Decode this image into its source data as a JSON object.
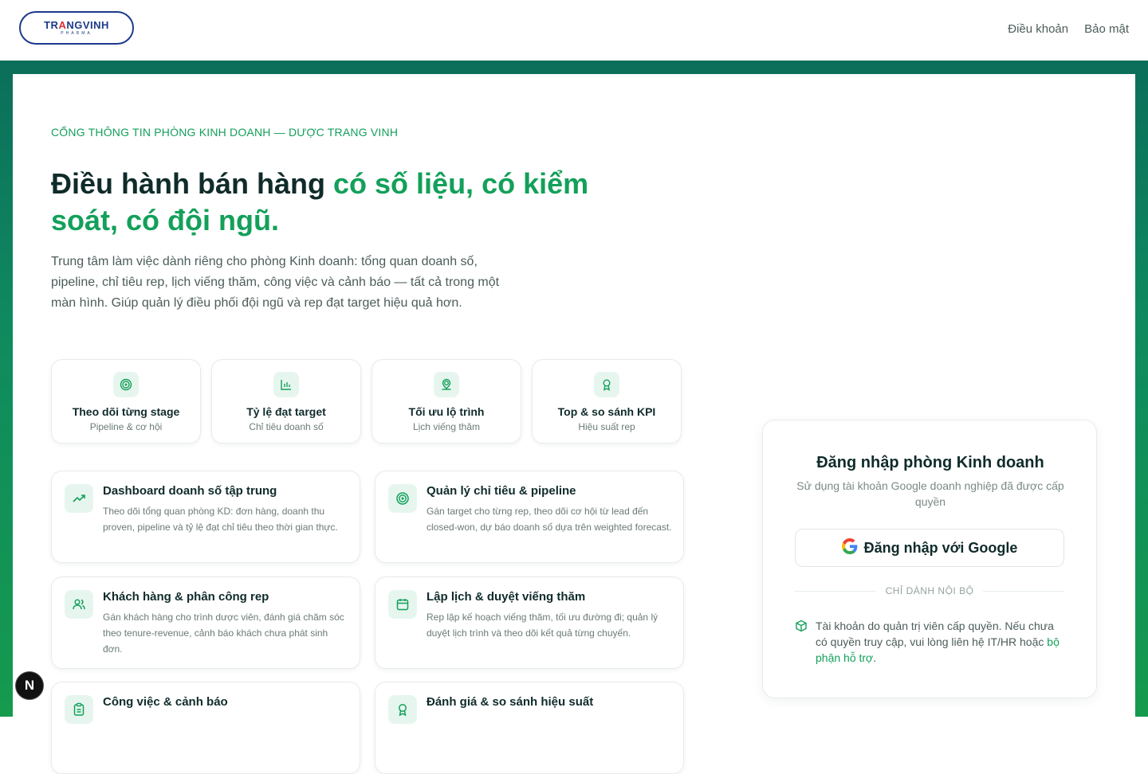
{
  "header": {
    "logo": {
      "brand_a": "TR",
      "brand_accent": "A",
      "brand_b": "NGVINH",
      "sub": "PHARMA"
    },
    "nav": [
      {
        "label": "Điều khoản"
      },
      {
        "label": "Bảo mật"
      }
    ]
  },
  "hero": {
    "eyebrow": "CỔNG THÔNG TIN PHÒNG KINH DOANH — DƯỢC TRANG VINH",
    "title_plain": "Điều hành bán hàng ",
    "title_highlight": "có số liệu, có kiểm soát, có đội ngũ.",
    "description": "Trung tâm làm việc dành riêng cho phòng Kinh doanh: tổng quan doanh số, pipeline, chỉ tiêu rep, lịch viếng thăm, công việc và cảnh báo — tất cả trong một màn hình. Giúp quản lý điều phối đội ngũ và rep đạt target hiệu quả hơn."
  },
  "stats": [
    {
      "title": "Theo dõi từng stage",
      "sub": "Pipeline & cơ hội",
      "icon": "target-icon"
    },
    {
      "title": "Tỷ lệ đạt target",
      "sub": "Chỉ tiêu doanh số",
      "icon": "bar-chart-icon"
    },
    {
      "title": "Tối ưu lộ trình",
      "sub": "Lịch viếng thăm",
      "icon": "map-pin-icon"
    },
    {
      "title": "Top & so sánh KPI",
      "sub": "Hiệu suất rep",
      "icon": "award-icon"
    }
  ],
  "features": [
    {
      "title": "Dashboard doanh số tập trung",
      "desc": "Theo dõi tổng quan phòng KD: đơn hàng, doanh thu proven, pipeline và tỷ lệ đạt chỉ tiêu theo thời gian thực.",
      "icon": "trending-up-icon"
    },
    {
      "title": "Quản lý chỉ tiêu & pipeline",
      "desc": "Gán target cho từng rep, theo dõi cơ hội từ lead đến closed-won, dự báo doanh số dựa trên weighted forecast.",
      "icon": "target-icon"
    },
    {
      "title": "Khách hàng & phân công rep",
      "desc": "Gán khách hàng cho trình dược viên, đánh giá chăm sóc theo tenure-revenue, cảnh báo khách chưa phát sinh đơn.",
      "icon": "users-icon"
    },
    {
      "title": "Lập lịch & duyệt viếng thăm",
      "desc": "Rep lập kế hoạch viếng thăm, tối ưu đường đi; quản lý duyệt lịch trình và theo dõi kết quả từng chuyến.",
      "icon": "calendar-icon"
    },
    {
      "title": "Công việc & cảnh báo",
      "desc": "",
      "icon": "clipboard-icon"
    },
    {
      "title": "Đánh giá & so sánh hiệu suất",
      "desc": "",
      "icon": "award-icon"
    }
  ],
  "login": {
    "title": "Đăng nhập phòng Kinh doanh",
    "subtitle": "Sử dụng tài khoản Google doanh nghiệp đã được cấp quyền",
    "google_button": "Đăng nhập với Google",
    "divider": "CHỈ DÀNH NỘI BỘ",
    "note_text": "Tài khoản do quản trị viên cấp quyền. Nếu chưa có quyền truy cập, vui lòng liên hệ IT/HR hoặc ",
    "note_link": "bộ phận hỗ trợ",
    "note_end": "."
  },
  "dev_badge": "N",
  "colors": {
    "accent": "#13a05a",
    "dark": "#0f2b2a",
    "frame": "#0b6e5a",
    "brand": "#1d3a8a"
  }
}
